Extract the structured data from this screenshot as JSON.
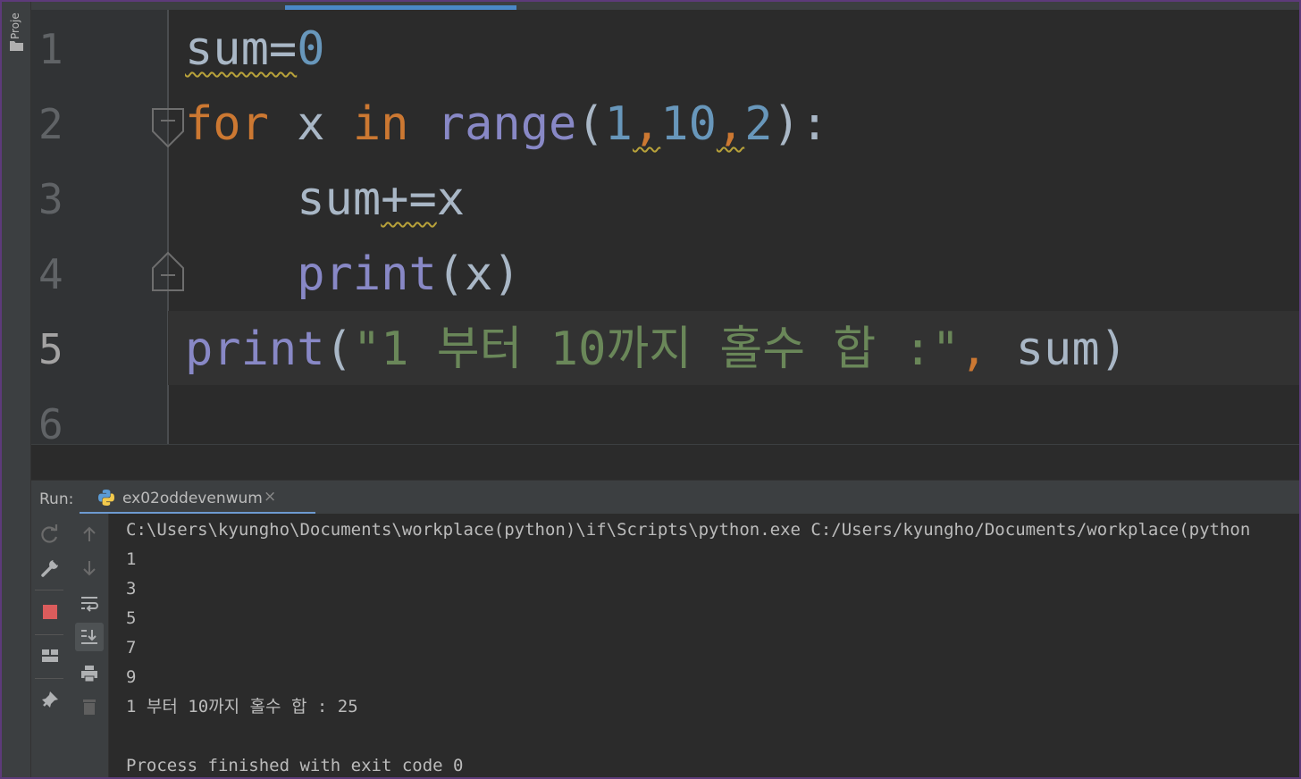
{
  "sidebar": {
    "project_tab": "Proje"
  },
  "editor": {
    "line_numbers": [
      "1",
      "2",
      "3",
      "4",
      "5",
      "6"
    ],
    "current_line": "5",
    "lines": [
      {
        "indent": "",
        "tokens": [
          {
            "t": "sum=",
            "c": "default",
            "wavy": true
          },
          {
            "t": "0",
            "c": "num"
          }
        ]
      },
      {
        "indent": "",
        "tokens": [
          {
            "t": "for",
            "c": "kw"
          },
          {
            "t": " x ",
            "c": "default"
          },
          {
            "t": "in",
            "c": "kw"
          },
          {
            "t": " ",
            "c": "default"
          },
          {
            "t": "range",
            "c": "builtin"
          },
          {
            "t": "(",
            "c": "default"
          },
          {
            "t": "1",
            "c": "num"
          },
          {
            "t": ",",
            "c": "kw",
            "wavy": true
          },
          {
            "t": "10",
            "c": "num"
          },
          {
            "t": ",",
            "c": "kw",
            "wavy": true
          },
          {
            "t": "2",
            "c": "num"
          },
          {
            "t": "):",
            "c": "default"
          }
        ]
      },
      {
        "indent": "    ",
        "tokens": [
          {
            "t": "sum",
            "c": "default"
          },
          {
            "t": "+=",
            "c": "default",
            "wavy": true
          },
          {
            "t": "x",
            "c": "default"
          }
        ]
      },
      {
        "indent": "    ",
        "tokens": [
          {
            "t": "print",
            "c": "builtin"
          },
          {
            "t": "(x)",
            "c": "default"
          }
        ]
      },
      {
        "indent": "",
        "tokens": [
          {
            "t": "print",
            "c": "builtin"
          },
          {
            "t": "(",
            "c": "default"
          },
          {
            "t": "\"1 부터 10까지 홀수 합 :\"",
            "c": "str"
          },
          {
            "t": ", ",
            "c": "kw"
          },
          {
            "t": "sum)",
            "c": "default"
          }
        ]
      },
      {
        "indent": "",
        "tokens": []
      }
    ]
  },
  "run_panel": {
    "label": "Run:",
    "tab_label": "ex02oddevenwum",
    "tab_close": "×",
    "toolbar_icons": [
      "rerun-icon",
      "settings-wrench-icon",
      "stop-icon",
      "layout-icon",
      "pin-icon",
      "scroll-up-icon",
      "scroll-down-icon",
      "soft-wrap-icon",
      "scroll-to-end-icon",
      "print-icon",
      "trash-icon"
    ]
  },
  "console": {
    "lines": [
      "C:\\Users\\kyungho\\Documents\\workplace(python)\\if\\Scripts\\python.exe C:/Users/kyungho/Documents/workplace(python",
      "1",
      "3",
      "5",
      "7",
      "9",
      "1 부터 10까지 홀수 합 : 25",
      "",
      "Process finished with exit code 0"
    ]
  },
  "colors": {
    "keyword": "#cc7832",
    "number": "#6897bb",
    "builtin": "#8888c6",
    "string": "#6a8759",
    "default": "#a9b7c6",
    "stop_red": "#db5c5c",
    "tab_accent": "#4a88c7"
  }
}
